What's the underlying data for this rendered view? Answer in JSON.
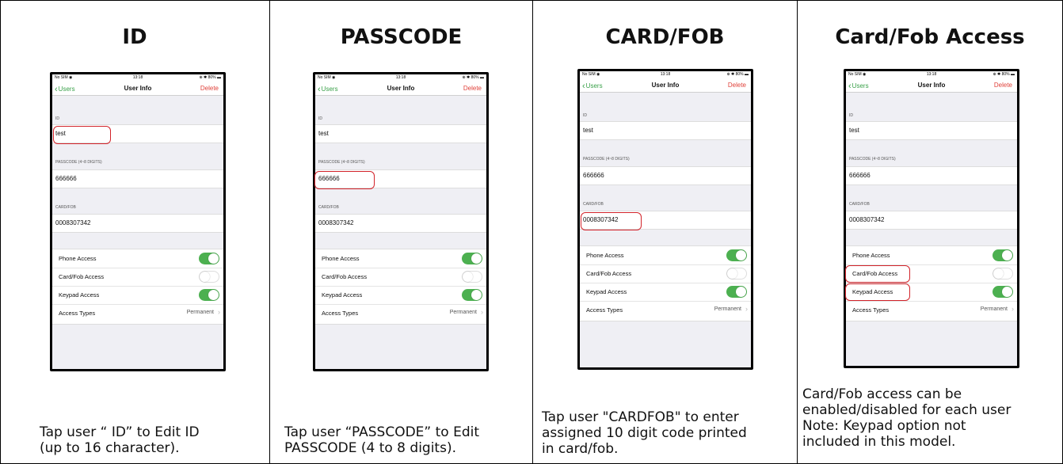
{
  "columns": [
    {
      "title": "ID",
      "caption": "Tap user “ ID” to Edit ID\n(up to 16 character)."
    },
    {
      "title": "PASSCODE",
      "caption": "Tap user “PASSCODE” to Edit\nPASSCODE (4 to 8 digits)."
    },
    {
      "title": "CARD/FOB",
      "caption": "Tap user \"CARDFOB\" to enter\nassigned 10 digit code printed\nin card/fob."
    },
    {
      "title": "Card/Fob Access",
      "caption": "Card/Fob access can be\nenabled/disabled for each user\nNote: Keypad option not\nincluded in this model."
    }
  ],
  "phone": {
    "status_left": "No SIM ◉",
    "status_time": "13:18",
    "status_right": "⊕ ✱ 80% ▬",
    "back_label": "Users",
    "nav_title": "User Info",
    "delete_label": "Delete",
    "id_label": "ID",
    "id_value": "test",
    "passcode_label": "PASSCODE (4~8 DIGITS)",
    "passcode_value": "666666",
    "cardfob_label": "CARD/FOB",
    "cardfob_value": "0008307342",
    "phone_access_label": "Phone Access",
    "cardfob_access_label": "Card/Fob Access",
    "keypad_access_label": "Keypad Access",
    "access_types_label": "Access Types",
    "access_types_value": "Permanent",
    "toggles": {
      "phone_access": true,
      "cardfob_access": false,
      "keypad_access": true
    }
  },
  "colors": {
    "accent_green": "#4cb050",
    "delete_red": "#e0413a",
    "highlight_red": "#d2232a"
  }
}
